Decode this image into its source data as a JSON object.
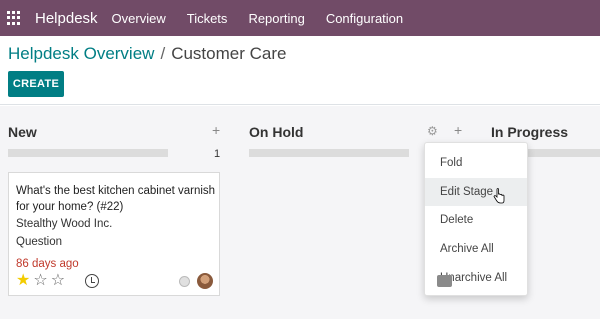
{
  "navbar": {
    "brand": "Helpdesk",
    "items": [
      "Overview",
      "Tickets",
      "Reporting",
      "Configuration"
    ],
    "color": "#714b67"
  },
  "breadcrumb": {
    "parent": "Helpdesk Overview",
    "separator": "/",
    "current": "Customer Care"
  },
  "actions": {
    "create_label": "CREATE"
  },
  "columns": [
    {
      "title": "New",
      "count": "1"
    },
    {
      "title": "On Hold"
    },
    {
      "title": "In Progress"
    }
  ],
  "icons": {
    "plus": "+",
    "gear": "⚙"
  },
  "card": {
    "title": "What's the best kitchen cabinet varnish for your home? (#22)",
    "customer": "Stealthy Wood Inc.",
    "type": "Question",
    "age": "86 days ago",
    "priority": 1,
    "priority_max": 3
  },
  "stage_menu": {
    "items": [
      "Fold",
      "Edit Stage",
      "Delete",
      "Archive All",
      "Unarchive All"
    ],
    "hovered": "Edit Stage"
  },
  "colors": {
    "accent": "#017e84",
    "danger": "#c0392b",
    "star": "#f3cc00"
  }
}
